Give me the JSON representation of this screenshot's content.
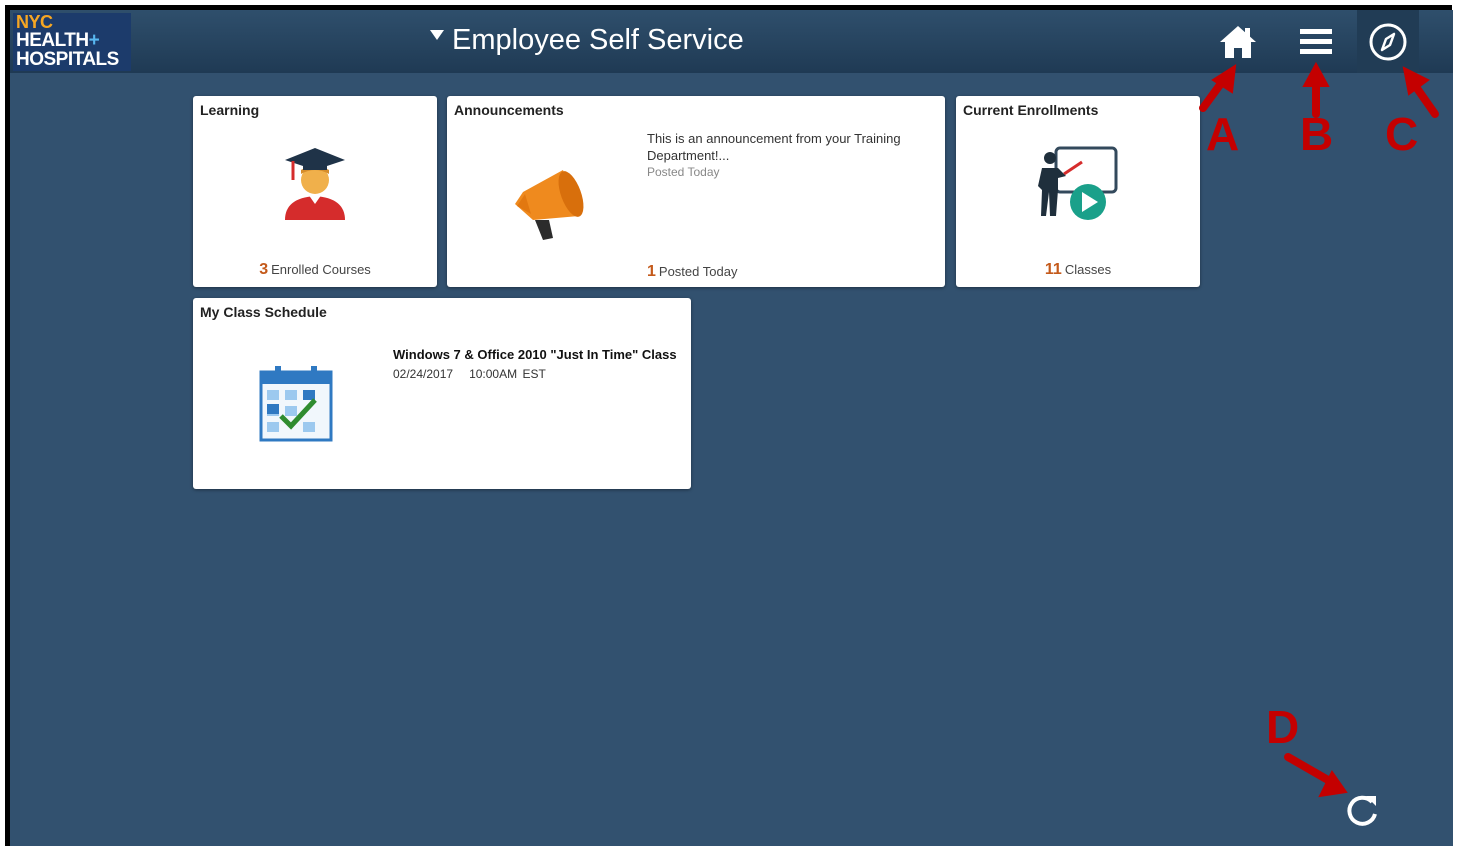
{
  "logo": {
    "line1": "NYC",
    "line2": "HEALTH",
    "plus": "+",
    "line3": "HOSPITALS"
  },
  "header": {
    "title": "Employee Self Service"
  },
  "nav": {
    "home_icon": "home-icon",
    "menu_icon": "menu-icon",
    "navbar_icon": "compass-icon"
  },
  "tiles": {
    "learning": {
      "title": "Learning",
      "count": "3",
      "count_label": "Enrolled Courses"
    },
    "announcements": {
      "title": "Announcements",
      "text": "This is an announcement from your Training Department!...",
      "posted": "Posted Today",
      "count": "1",
      "count_label": "Posted Today"
    },
    "enrollments": {
      "title": "Current Enrollments",
      "count": "11",
      "count_label": "Classes"
    },
    "schedule": {
      "title": "My Class Schedule",
      "class_name": "Windows 7 & Office 2010 \"Just In Time\" Class",
      "date": "02/24/2017",
      "time": "10:00AM EST"
    }
  },
  "markers": {
    "a": "A",
    "b": "B",
    "c": "C",
    "d": "D"
  },
  "colors": {
    "background": "#32516f",
    "accent_count": "#c45a1b",
    "marker": "#c40000"
  }
}
